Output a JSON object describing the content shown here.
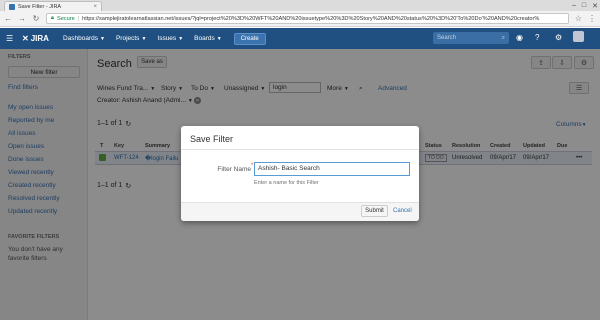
{
  "browser": {
    "tab_title": "Save Filter - JIRA",
    "tab_close": "×",
    "secure_label": "Secure",
    "url": "https://samplejiratolearnatlassian.net/issues/?jql=project%20%3D%20WFT%20AND%20issuetype%20%3D%20Story%20AND%20status%20%3D%20'To%20Do'%20AND%20creator%"
  },
  "header": {
    "logo": "JIRA",
    "nav": [
      {
        "label": "Dashboards"
      },
      {
        "label": "Projects"
      },
      {
        "label": "Issues"
      },
      {
        "label": "Boards"
      }
    ],
    "create_label": "Create",
    "search_placeholder": "Search"
  },
  "sidebar": {
    "filters_title": "FILTERS",
    "new_filter_label": "New filter",
    "find_filters": "Find filters",
    "items": [
      {
        "label": "My open issues"
      },
      {
        "label": "Reported by me"
      },
      {
        "label": "All issues"
      },
      {
        "label": "Open issues"
      },
      {
        "label": "Done issues"
      },
      {
        "label": "Viewed recently"
      },
      {
        "label": "Created recently"
      },
      {
        "label": "Resolved recently"
      },
      {
        "label": "Updated recently"
      }
    ],
    "favorite_title": "FAVORITE FILTERS",
    "favorite_empty": "You don't have any favorite filters"
  },
  "main": {
    "title": "Search",
    "save_as": "Save as",
    "criteria": {
      "project": "Wines Fund Tra...",
      "type": "Story",
      "status": "To Do",
      "assignee": "Unassigned",
      "text": "login",
      "more": "More",
      "advanced": "Advanced",
      "creator": "Creator: Ashish Anand (Admi..."
    },
    "results_count": "1–1 of 1",
    "columns_label": "Columns",
    "columns": {
      "t": "T",
      "key": "Key",
      "summary": "Summary",
      "status": "Status",
      "resolution": "Resolution",
      "created": "Created",
      "updated": "Updated",
      "due": "Due"
    },
    "row": {
      "key": "WFT-124",
      "summary": "�login Failu",
      "status": "TO DO",
      "resolution": "Unresolved",
      "created": "09/Apr/17",
      "updated": "09/Apr/17"
    },
    "results_count_bottom": "1–1 of 1"
  },
  "dialog": {
    "title": "Save Filter",
    "field_label": "Filter Name",
    "required_marker": "*",
    "field_value": "Ashish- Basic Search",
    "help_text": "Enter a name for this Filter",
    "submit_label": "Submit",
    "cancel_label": "Cancel"
  },
  "colors": {
    "header_bg": "#205081",
    "link": "#3572b0",
    "overlay": "rgba(0,0,0,0.45)"
  }
}
